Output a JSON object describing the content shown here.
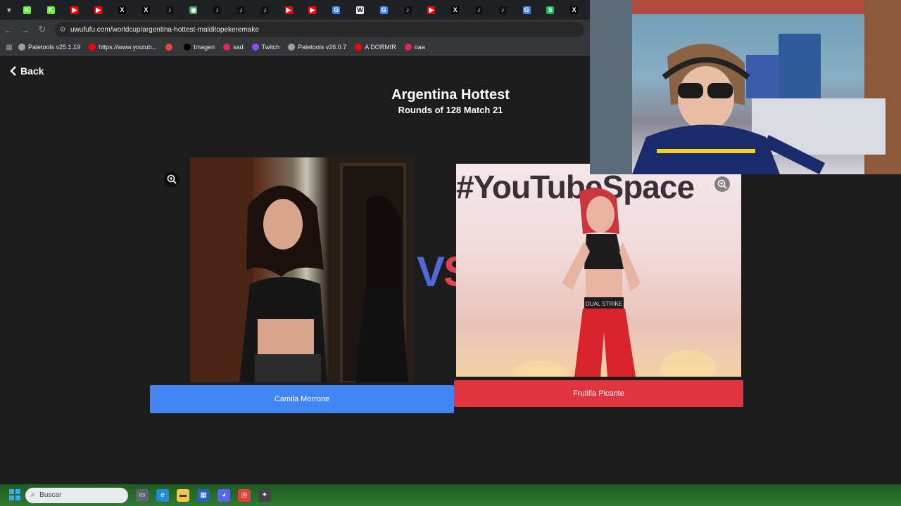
{
  "browser": {
    "url": "uwufufu.com/worldcup/argentina-hottest-malditopekeremake",
    "tabs": [
      {
        "icon": "kick-icon",
        "color": "#53fc18",
        "glyph": "K"
      },
      {
        "icon": "kick-icon",
        "color": "#53fc18",
        "glyph": "K"
      },
      {
        "icon": "youtube-icon",
        "color": "#ff0000",
        "glyph": "▶"
      },
      {
        "icon": "youtube-icon",
        "color": "#ff0000",
        "glyph": "▶"
      },
      {
        "icon": "x-icon",
        "color": "#000000",
        "glyph": "X"
      },
      {
        "icon": "x-icon",
        "color": "#000000",
        "glyph": "X"
      },
      {
        "icon": "tiktok-icon",
        "color": "#111111",
        "glyph": "♪"
      },
      {
        "icon": "globe-icon",
        "color": "#34a853",
        "glyph": "◉"
      },
      {
        "icon": "tiktok-icon",
        "color": "#111111",
        "glyph": "♪"
      },
      {
        "icon": "tiktok-icon",
        "color": "#111111",
        "glyph": "♪"
      },
      {
        "icon": "tiktok-icon",
        "color": "#111111",
        "glyph": "♪"
      },
      {
        "icon": "youtube-icon",
        "color": "#ff0000",
        "glyph": "▶"
      },
      {
        "icon": "youtube-icon",
        "color": "#ff0000",
        "glyph": "▶"
      },
      {
        "icon": "google-icon",
        "color": "#4285f4",
        "glyph": "G"
      },
      {
        "icon": "wikipedia-icon",
        "color": "#ffffff",
        "glyph": "W"
      },
      {
        "icon": "google-icon",
        "color": "#4285f4",
        "glyph": "G"
      },
      {
        "icon": "tiktok-icon",
        "color": "#111111",
        "glyph": "♪"
      },
      {
        "icon": "youtube-icon",
        "color": "#ff0000",
        "glyph": "▶"
      },
      {
        "icon": "x-icon",
        "color": "#000000",
        "glyph": "X"
      },
      {
        "icon": "tiktok-icon",
        "color": "#111111",
        "glyph": "♪"
      },
      {
        "icon": "tiktok-icon",
        "color": "#111111",
        "glyph": "♪"
      },
      {
        "icon": "google-icon",
        "color": "#4285f4",
        "glyph": "G"
      },
      {
        "icon": "spotify-icon",
        "color": "#1db954",
        "glyph": "S"
      },
      {
        "icon": "x-icon",
        "color": "#000000",
        "glyph": "X"
      }
    ],
    "bookmarks": [
      {
        "label": "Paletools v25.1.19",
        "color": "#9aa0a6"
      },
      {
        "label": "https://www.youtub...",
        "color": "#ff0000"
      },
      {
        "label": "",
        "color": "#e8453c"
      },
      {
        "label": "Imagen",
        "color": "#000000"
      },
      {
        "label": "sad",
        "color": "#e0245e"
      },
      {
        "label": "Twitch",
        "color": "#9146ff"
      },
      {
        "label": "Paletools v26.0.7",
        "color": "#9aa0a6"
      },
      {
        "label": "A DORMIR",
        "color": "#ff0000"
      },
      {
        "label": "oaa",
        "color": "#e0245e"
      }
    ]
  },
  "page": {
    "back_label": "Back",
    "title": "Argentina Hottest",
    "subtitle": "Rounds of 128 Match 21",
    "vs_left": "V",
    "vs_right": "S",
    "banner_text": "#YouTubeSpace",
    "shirt_text": "DUAL STRIKE",
    "choices": [
      {
        "label": "Camila Morrone",
        "color": "#4285f4"
      },
      {
        "label": "Frutilla Picante",
        "color": "#e0343f"
      }
    ]
  },
  "taskbar": {
    "search_placeholder": "Buscar"
  }
}
